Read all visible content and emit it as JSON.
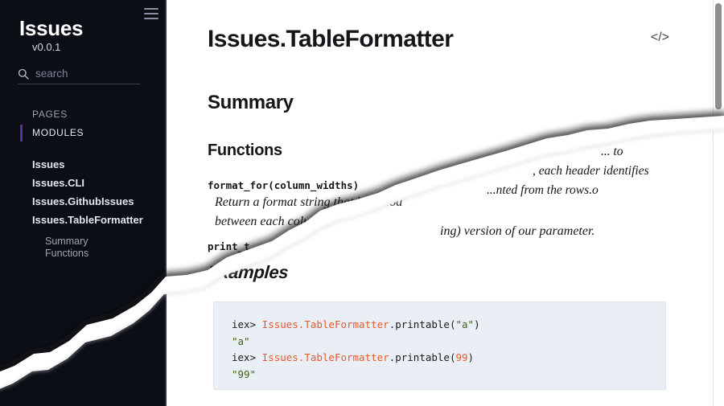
{
  "sidebar": {
    "menu_icon": "hamburger-icon",
    "brand": {
      "title": "Issues",
      "version": "v0.0.1"
    },
    "search": {
      "icon": "search-icon",
      "placeholder": "search",
      "value": ""
    },
    "sections": [
      {
        "label": "PAGES",
        "active": false
      },
      {
        "label": "MODULES",
        "active": true
      }
    ],
    "modules": [
      {
        "label": "Issues"
      },
      {
        "label": "Issues.CLI"
      },
      {
        "label": "Issues.GithubIssues"
      },
      {
        "label": "Issues.TableFormatter"
      }
    ],
    "sub_items": [
      {
        "label": "Summary"
      },
      {
        "label": "Functions"
      }
    ],
    "colors": {
      "background": "#0c0e16",
      "active_marker": "#5e2ca5",
      "text": "#e4e6ec",
      "muted_text": "#9aa0b0"
    }
  },
  "content": {
    "title": "Issues.TableFormatter",
    "source_icon": "code-brackets-icon",
    "headings": {
      "summary": "Summary",
      "functions": "Functions",
      "examples": "Examples"
    },
    "functions": [
      {
        "signature": "format_for(column_widths)",
        "description_lines": [
          "Return a format string that hard cod",
          "between each colum",
          "ing) version of our parameter."
        ]
      },
      {
        "signature": "print_t",
        "description_lines": []
      }
    ],
    "occluded_fragments": [
      "... to",
      ", each header identifies",
      "...nted from the rows.o"
    ],
    "code_example": {
      "lines": [
        {
          "prompt": "iex> ",
          "module": "Issues.TableFormatter",
          "call": ".printable(",
          "arg": "\"a\"",
          "arg_type": "string",
          "close": ")"
        },
        {
          "output": "\"a\""
        },
        {
          "prompt": "iex> ",
          "module": "Issues.TableFormatter",
          "call": ".printable(",
          "arg": "99",
          "arg_type": "number",
          "close": ")"
        },
        {
          "output": "\"99\""
        }
      ],
      "colors": {
        "background": "#eaeff5",
        "module": "#e8582c",
        "string": "#3f6212",
        "number": "#e8582c"
      }
    }
  },
  "scrollbar": {
    "thumb_color": "#8e8e8e",
    "position_label": "top"
  },
  "overlay": {
    "effect": "page-tear-peel",
    "description": "Torn page flap sweeping from lower-left to upper-right"
  }
}
